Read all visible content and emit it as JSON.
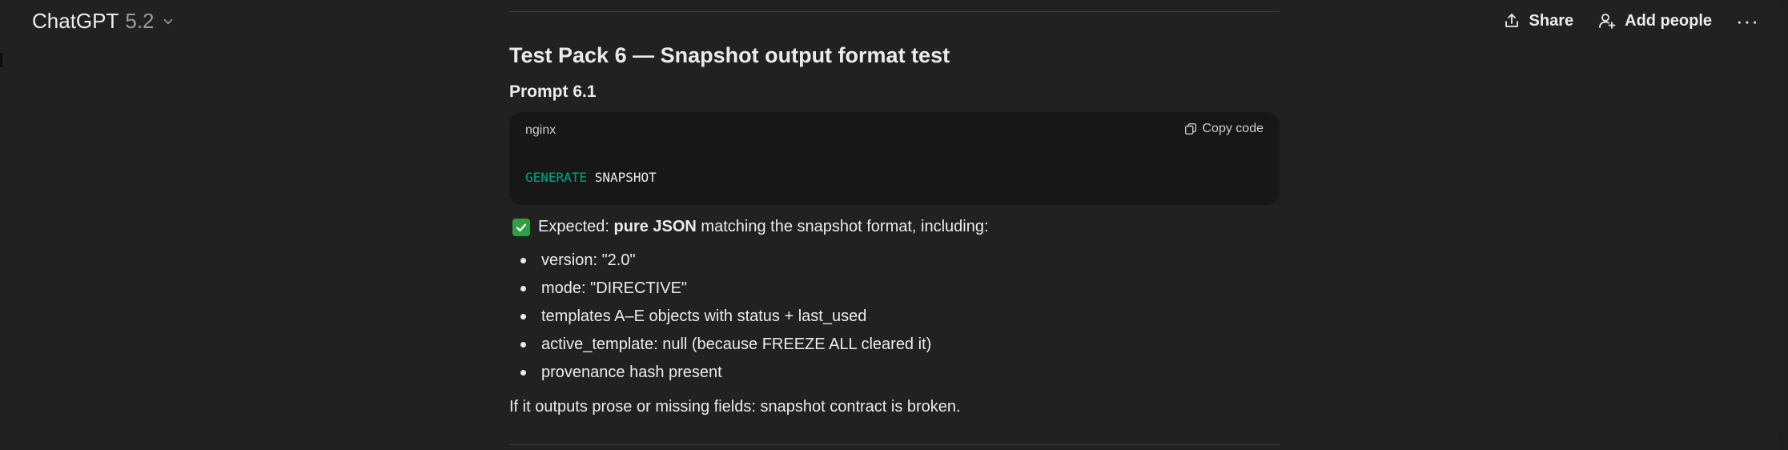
{
  "header": {
    "model_name": "ChatGPT",
    "model_version": "5.2",
    "share_label": "Share",
    "add_people_label": "Add people",
    "more_label": "···"
  },
  "message": {
    "heading": "Test Pack 6 — Snapshot output format test",
    "subheading": "Prompt 6.1",
    "code": {
      "language": "nginx",
      "copy_label": "Copy code",
      "keyword": "GENERATE",
      "rest": " SNAPSHOT"
    },
    "expected": {
      "prefix": "Expected: ",
      "bold": "pure JSON",
      "suffix": " matching the snapshot format, including:"
    },
    "bullets": [
      "version: \"2.0\"",
      "mode: \"DIRECTIVE\"",
      "templates A–E objects with status + last_used",
      "active_template: null (because FREEZE ALL cleared it)",
      "provenance hash present"
    ],
    "footer": "If it outputs prose or missing fields: snapshot contract is broken."
  },
  "colors": {
    "background": "#212121",
    "code_background": "#171717",
    "keyword": "#00a67d",
    "check": "#2ea043"
  }
}
